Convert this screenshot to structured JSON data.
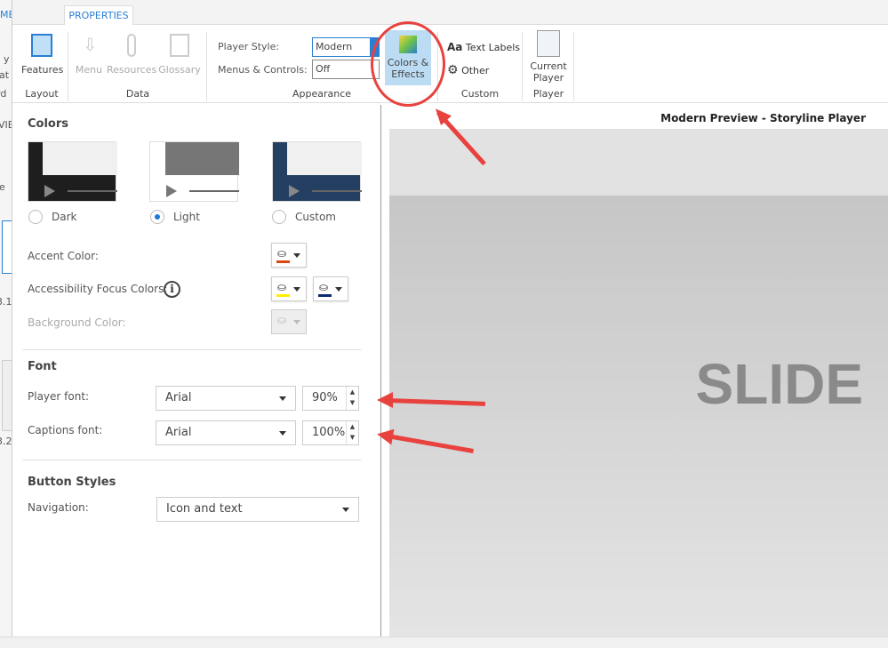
{
  "left_strip": {
    "fragments": [
      "ME",
      "y",
      "nat",
      "rd",
      "VIE",
      "le",
      "3.1",
      "3.2"
    ]
  },
  "ribbon": {
    "tab": "PROPERTIES",
    "groups": [
      {
        "label": "Layout",
        "buttons": [
          "Features"
        ]
      },
      {
        "label": "Data",
        "buttons": [
          "Menu",
          "Resources",
          "Glossary"
        ]
      },
      {
        "label": "Appearance",
        "player_style_label": "Player Style:",
        "player_style_value": "Modern",
        "menus_label": "Menus & Controls:",
        "menus_value": "Off",
        "colors_effects": "Colors & Effects"
      },
      {
        "label": "Custom",
        "buttons": [
          "Text Labels",
          "Other"
        ]
      },
      {
        "label": "Player",
        "buttons": [
          "Current Player"
        ]
      }
    ]
  },
  "colors": {
    "title": "Colors",
    "themes": [
      {
        "label": "Dark",
        "selected": false
      },
      {
        "label": "Light",
        "selected": true
      },
      {
        "label": "Custom",
        "selected": false
      }
    ],
    "accent_label": "Accent Color:",
    "accent_color": "#d9480f",
    "focus_label": "Accessibility Focus Colors:",
    "focus_colors": [
      "#ffee00",
      "#0a2a6e"
    ],
    "background_label": "Background Color:"
  },
  "font": {
    "title": "Font",
    "player_label": "Player font:",
    "player_font": "Arial",
    "player_size": "90%",
    "captions_label": "Captions font:",
    "captions_font": "Arial",
    "captions_size": "100%"
  },
  "button_styles": {
    "title": "Button Styles",
    "navigation_label": "Navigation:",
    "navigation_value": "Icon and text"
  },
  "preview": {
    "title": "Modern Preview - Storyline Player",
    "slide_text": "SLIDE"
  },
  "annotation_color": "#e8423f"
}
